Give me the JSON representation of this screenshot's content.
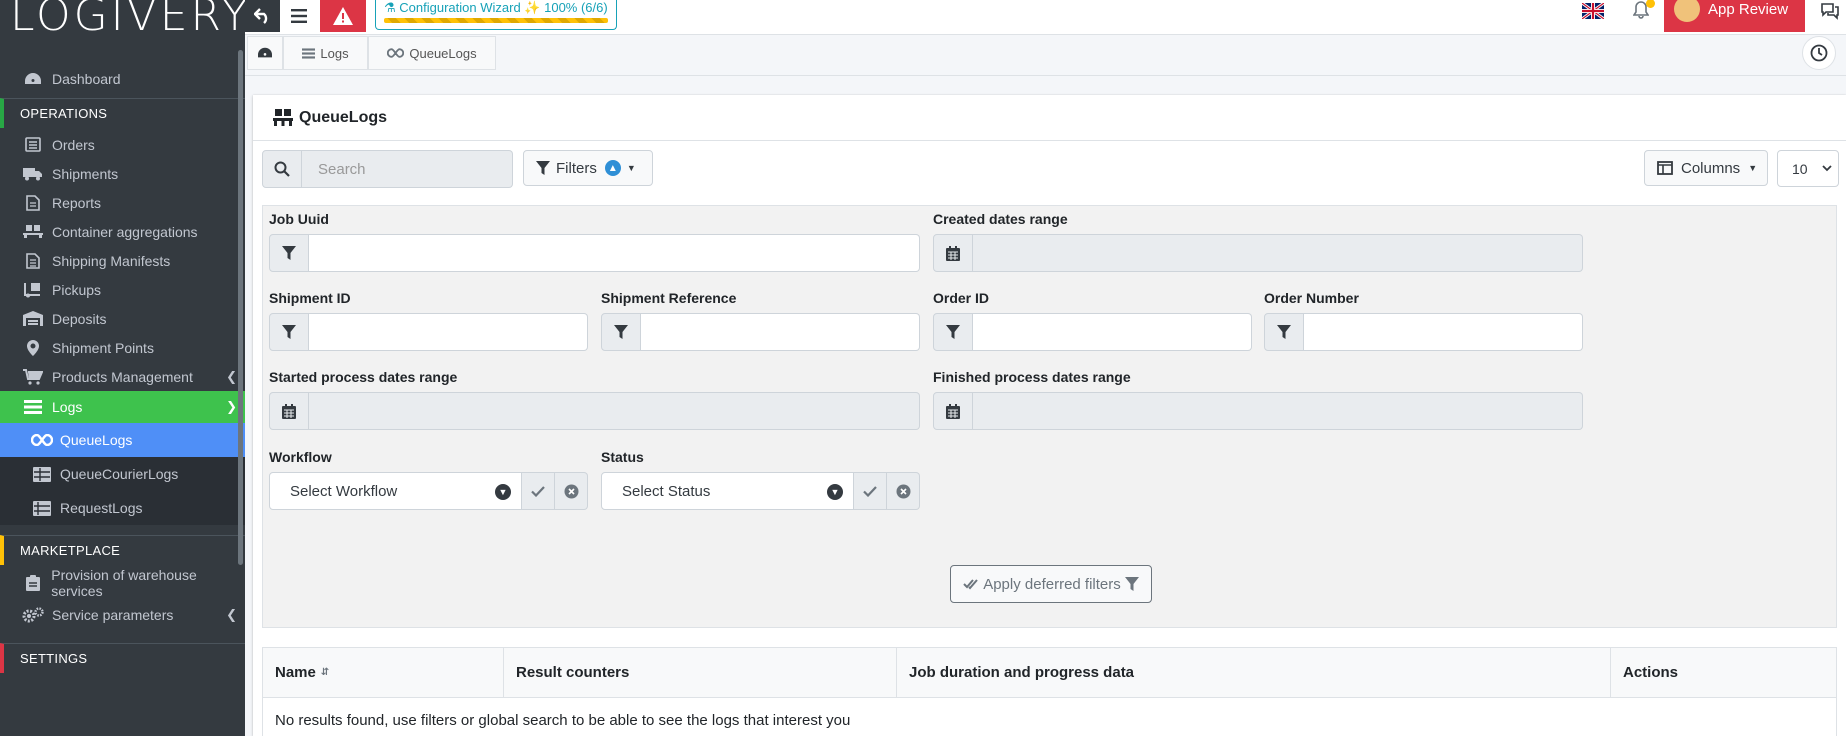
{
  "brand": {
    "logo": "LOGIVERY"
  },
  "topbar": {
    "wizard_label": "Configuration Wizard",
    "wizard_progress": "100% (6/6)",
    "app_review": "App Review"
  },
  "sidebar": {
    "dashboard": "Dashboard",
    "sec_operations": "OPERATIONS",
    "orders": "Orders",
    "shipments": "Shipments",
    "reports": "Reports",
    "container_aggregations": "Container aggregations",
    "shipping_manifests": "Shipping Manifests",
    "pickups": "Pickups",
    "deposits": "Deposits",
    "shipment_points": "Shipment Points",
    "products_management": "Products Management",
    "logs": "Logs",
    "queue_logs": "QueueLogs",
    "queue_courier_logs": "QueueCourierLogs",
    "request_logs": "RequestLogs",
    "sec_marketplace": "MARKETPLACE",
    "provision": "Provision of warehouse services",
    "service_parameters": "Service parameters",
    "sec_settings": "SETTINGS"
  },
  "breadcrumb": {
    "logs": "Logs",
    "queue_logs": "QueueLogs"
  },
  "page": {
    "title": "QueueLogs"
  },
  "toolbar": {
    "search_placeholder": "Search",
    "filters": "Filters",
    "columns": "Columns",
    "page_size": "10"
  },
  "filters": {
    "job_uuid": "Job Uuid",
    "created_dates_range": "Created dates range",
    "shipment_id": "Shipment ID",
    "shipment_reference": "Shipment Reference",
    "order_id": "Order ID",
    "order_number": "Order Number",
    "started_process_dates_range": "Started process dates range",
    "finished_process_dates_range": "Finished process dates range",
    "workflow": "Workflow",
    "workflow_placeholder": "Select Workflow",
    "status": "Status",
    "status_placeholder": "Select Status",
    "apply": "Apply deferred filters"
  },
  "table": {
    "columns": [
      "Name",
      "Result counters",
      "Job duration and progress data",
      "Actions"
    ],
    "empty": "No results found, use filters or global search to be able to see the logs that interest you"
  }
}
